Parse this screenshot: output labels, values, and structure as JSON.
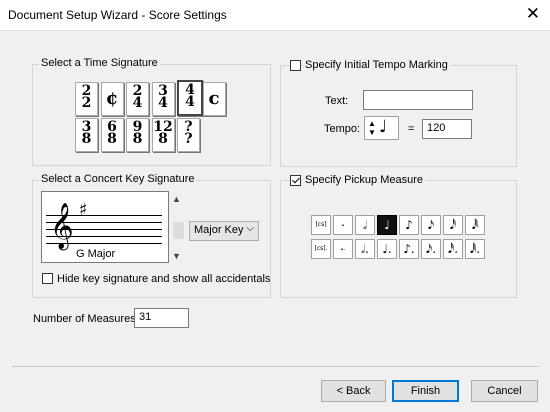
{
  "window": {
    "title": "Document Setup Wizard - Score Settings",
    "close_glyph": "✕"
  },
  "time_signature": {
    "label": "Select a Time Signature",
    "row1": [
      {
        "top": "2",
        "bottom": "2"
      },
      {
        "symbol": "¢"
      },
      {
        "top": "2",
        "bottom": "4"
      },
      {
        "top": "3",
        "bottom": "4"
      },
      {
        "top": "4",
        "bottom": "4",
        "selected": true
      },
      {
        "symbol": "c"
      }
    ],
    "row2": [
      {
        "top": "3",
        "bottom": "8"
      },
      {
        "top": "6",
        "bottom": "8"
      },
      {
        "top": "9",
        "bottom": "8"
      },
      {
        "top": "12",
        "bottom": "8"
      },
      {
        "top": "?",
        "bottom": "?"
      }
    ]
  },
  "concert_key": {
    "label": "Select a Concert Key Signature",
    "key_name": "G Major",
    "mode_select": "Major Key",
    "hide_key_label": "Hide key signature and show all accidentals",
    "hide_key_checked": false
  },
  "measures": {
    "label": "Number of Measures:",
    "value": "31"
  },
  "tempo": {
    "label": "Specify Initial Tempo Marking",
    "checked": false,
    "text_label": "Text:",
    "text_value": "",
    "tempo_label": "Tempo:",
    "equals": "=",
    "value": "120"
  },
  "pickup": {
    "label": "Specify Pickup Measure",
    "checked": true,
    "row1": [
      "[cs]",
      "𝅝",
      "𝅗𝅥",
      "♩",
      "♪",
      "𝅘𝅥𝅯",
      "𝅘𝅥𝅰",
      "𝅘𝅥𝅱"
    ],
    "row2": [
      "[cs].",
      "𝅝.",
      "𝅗𝅥.",
      "♩.",
      "♪.",
      "𝅘𝅥𝅯.",
      "𝅘𝅥𝅰.",
      "𝅘𝅥𝅱."
    ],
    "selected_index": 3
  },
  "buttons": {
    "back": "< Back",
    "finish": "Finish",
    "cancel": "Cancel"
  }
}
